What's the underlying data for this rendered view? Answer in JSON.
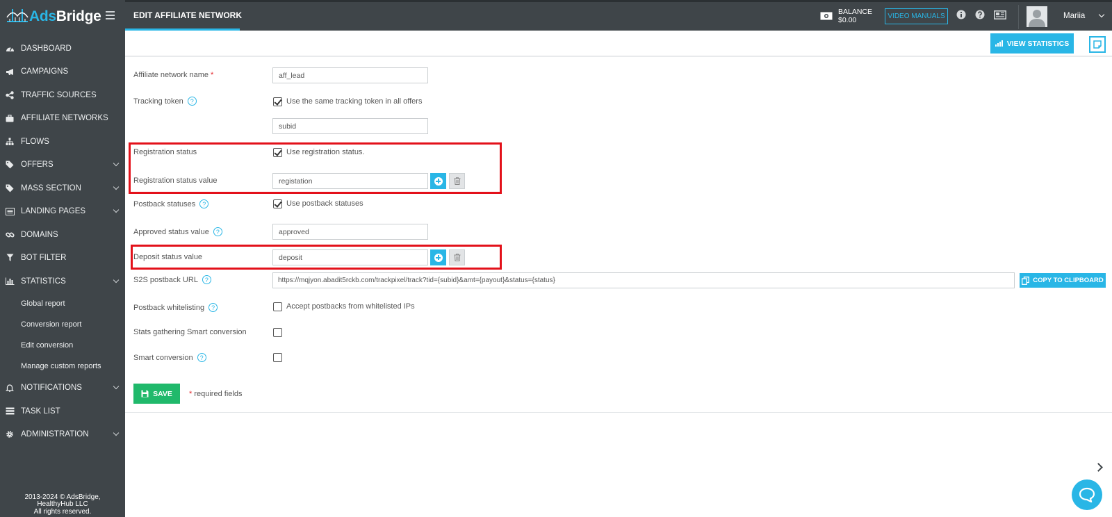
{
  "app": {
    "logo_ads": "Ads",
    "logo_bridge": "Bridge",
    "copyright": [
      "2013-2024 © AdsBridge,",
      "HealthyHub LLC",
      "All rights reserved."
    ]
  },
  "sidebar": {
    "items": [
      {
        "label": "DASHBOARD",
        "icon": "dashboard-icon"
      },
      {
        "label": "CAMPAIGNS",
        "icon": "megaphone-icon"
      },
      {
        "label": "TRAFFIC SOURCES",
        "icon": "share-icon"
      },
      {
        "label": "AFFILIATE NETWORKS",
        "icon": "briefcase-icon"
      },
      {
        "label": "FLOWS",
        "icon": "sitemap-icon"
      },
      {
        "label": "OFFERS",
        "icon": "tags-icon",
        "expandable": true
      },
      {
        "label": "MASS SECTION",
        "icon": "tags-icon",
        "expandable": true
      },
      {
        "label": "LANDING PAGES",
        "icon": "list-icon",
        "expandable": true
      },
      {
        "label": "DOMAINS",
        "icon": "link-icon"
      },
      {
        "label": "BOT FILTER",
        "icon": "filter-icon"
      },
      {
        "label": "STATISTICS",
        "icon": "bar-chart-icon",
        "expandable": true
      }
    ],
    "statistics_sub": [
      "Global report",
      "Conversion report",
      "Edit conversion",
      "Manage custom reports"
    ],
    "items_after": [
      {
        "label": "NOTIFICATIONS",
        "icon": "bell-icon",
        "expandable": true
      },
      {
        "label": "TASK LIST",
        "icon": "tasks-icon"
      },
      {
        "label": "ADMINISTRATION",
        "icon": "gear-icon",
        "expandable": true
      }
    ]
  },
  "topbar": {
    "page_title": "EDIT AFFILIATE NETWORK",
    "balance_label": "BALANCE",
    "balance_value": "$0.00",
    "video_manuals": "VIDEO MANUALS",
    "user_name": "Mariia"
  },
  "actions": {
    "view_statistics": "VIEW STATISTICS"
  },
  "form": {
    "network_name_label": "Affiliate network name",
    "network_name_value": "aff_lead",
    "tracking_token_label": "Tracking token",
    "tracking_token_check": "Use the same tracking token in all offers",
    "tracking_token_value": "subid",
    "registration_status_label": "Registration status",
    "registration_status_check": "Use registration status.",
    "registration_value_label": "Registration status value",
    "registration_value": "registation",
    "postback_statuses_label": "Postback statuses",
    "postback_statuses_check": "Use postback statuses",
    "approved_label": "Approved status value",
    "approved_value": "approved",
    "deposit_label": "Deposit status value",
    "deposit_value": "deposit",
    "s2s_label": "S2S postback URL",
    "s2s_value": "https://mqjyon.abadit5rckb.com/trackpixel/track?tid={subid}&amt={payout}&status={status}",
    "copy_button": "COPY TO CLIPBOARD",
    "whitelisting_label": "Postback whitelisting",
    "whitelisting_check": "Accept postbacks from whitelisted IPs",
    "stats_smart_label": "Stats gathering Smart conversion",
    "smart_label": "Smart conversion",
    "save_button": "SAVE",
    "required_note": "required fields",
    "required_mark": "*"
  },
  "colors": {
    "sidebar_bg": "#3f4549",
    "accent": "#29b6e6",
    "save": "#20b96b",
    "highlight": "#e3111a"
  }
}
